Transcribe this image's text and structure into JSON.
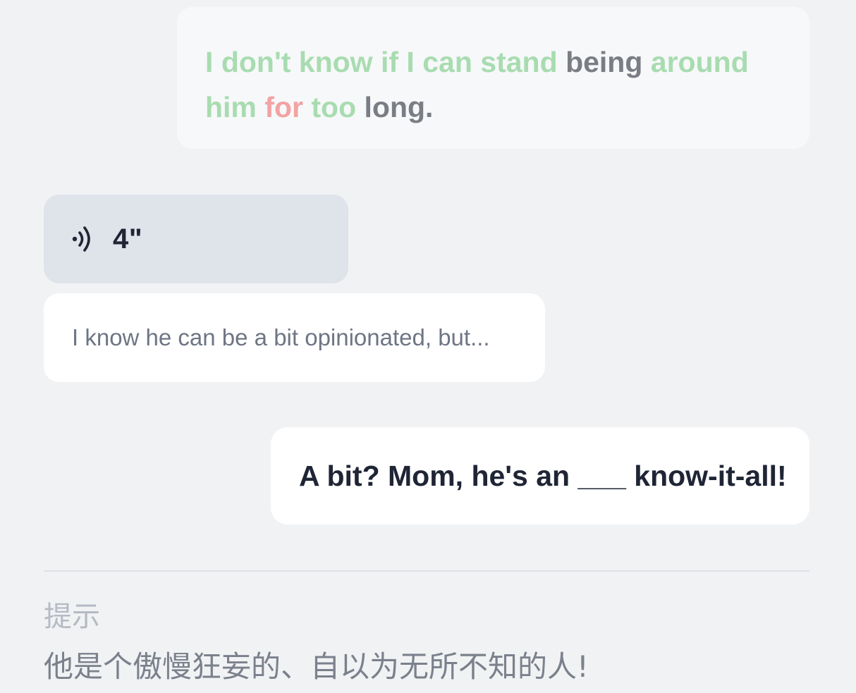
{
  "scored_sentence": {
    "words": [
      {
        "text": "I",
        "score": "good"
      },
      {
        "text": "don't",
        "score": "good"
      },
      {
        "text": "know",
        "score": "good"
      },
      {
        "text": "if",
        "score": "good"
      },
      {
        "text": "I",
        "score": "good"
      },
      {
        "text": "can",
        "score": "good"
      },
      {
        "text": "stand",
        "score": "good"
      },
      {
        "text": "being",
        "score": "ok"
      },
      {
        "text": "around",
        "score": "good"
      },
      {
        "text": "him",
        "score": "good"
      },
      {
        "text": "for",
        "score": "bad"
      },
      {
        "text": "too",
        "score": "good"
      },
      {
        "text": "long.",
        "score": "ok"
      }
    ],
    "colors": {
      "good": "#a8dcb0",
      "ok": "#7a7d84",
      "bad": "#f2a3a3"
    }
  },
  "audio": {
    "icon": "speaker-wave-icon",
    "duration": "4\""
  },
  "transcript": {
    "text": "I know he can be a bit opinionated, but..."
  },
  "question": {
    "text": "A bit? Mom, he's an ___ know-it-all!"
  },
  "hint": {
    "label": "提示",
    "text": "他是个傲慢狂妄的、自以为无所不知的人!"
  }
}
